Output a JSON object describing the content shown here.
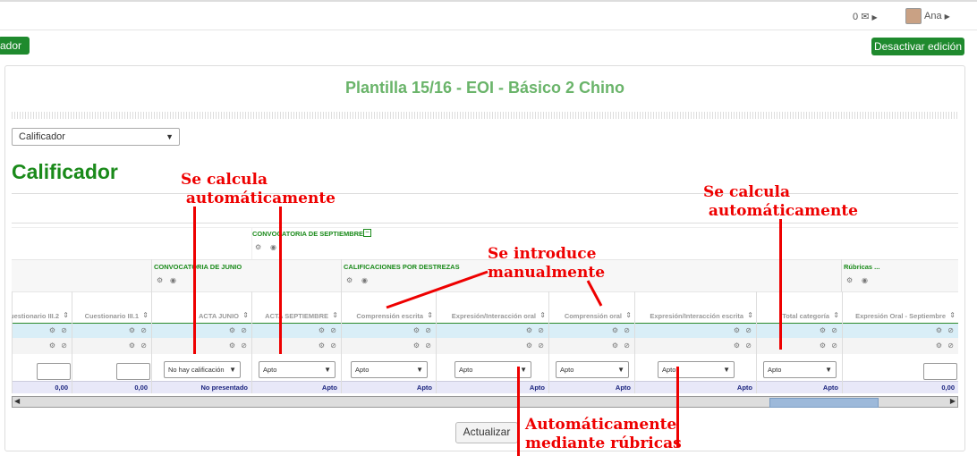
{
  "topbar": {
    "messages_count": "0",
    "user_name": "Ana"
  },
  "left_button": "ador",
  "right_button": "Desactivar edición",
  "page_title": "Plantilla 15/16 - EOI - Básico 2 Chino",
  "view_select": "Calificador",
  "heading": "Calificador",
  "categories": {
    "septiembre": "CONVOCATORIA DE SEPTIEMBRE",
    "junio": "CONVOCATORIA DE JUNIO",
    "destrezas": "CALIFICACIONES POR DESTREZAS",
    "rubricas": "Rúbricas ..."
  },
  "columns": [
    {
      "label": "uestionario III.2",
      "total": "0,00"
    },
    {
      "label": "Cuestionario III.1",
      "total": "0,00"
    },
    {
      "label": "ACTA JUNIO",
      "total": "No presentado",
      "select": "No hay calificación"
    },
    {
      "label": "ACTA SEPTIEMBRE",
      "total": "Apto",
      "select": "Apto"
    },
    {
      "label": "Comprensión escrita",
      "total": "Apto",
      "select": "Apto"
    },
    {
      "label": "Expresión/Interacción oral",
      "total": "Apto",
      "select": "Apto"
    },
    {
      "label": "Comprensión oral",
      "total": "Apto",
      "select": "Apto"
    },
    {
      "label": "Expresión/Interacción escrita",
      "total": "Apto",
      "select": "Apto"
    },
    {
      "label": "Total categoría",
      "total": "Apto",
      "select": "Apto"
    },
    {
      "label": "Expresión Oral - Septiembre",
      "total": "0,00"
    }
  ],
  "update_button": "Actualizar",
  "annotations": {
    "calc1": "Se calcula\n automáticamente",
    "manual": "Se introduce\nmanualmente",
    "calc2": "Se calcula\n automáticamente",
    "rubricas": "Automáticamente\nmediante rúbricas"
  }
}
